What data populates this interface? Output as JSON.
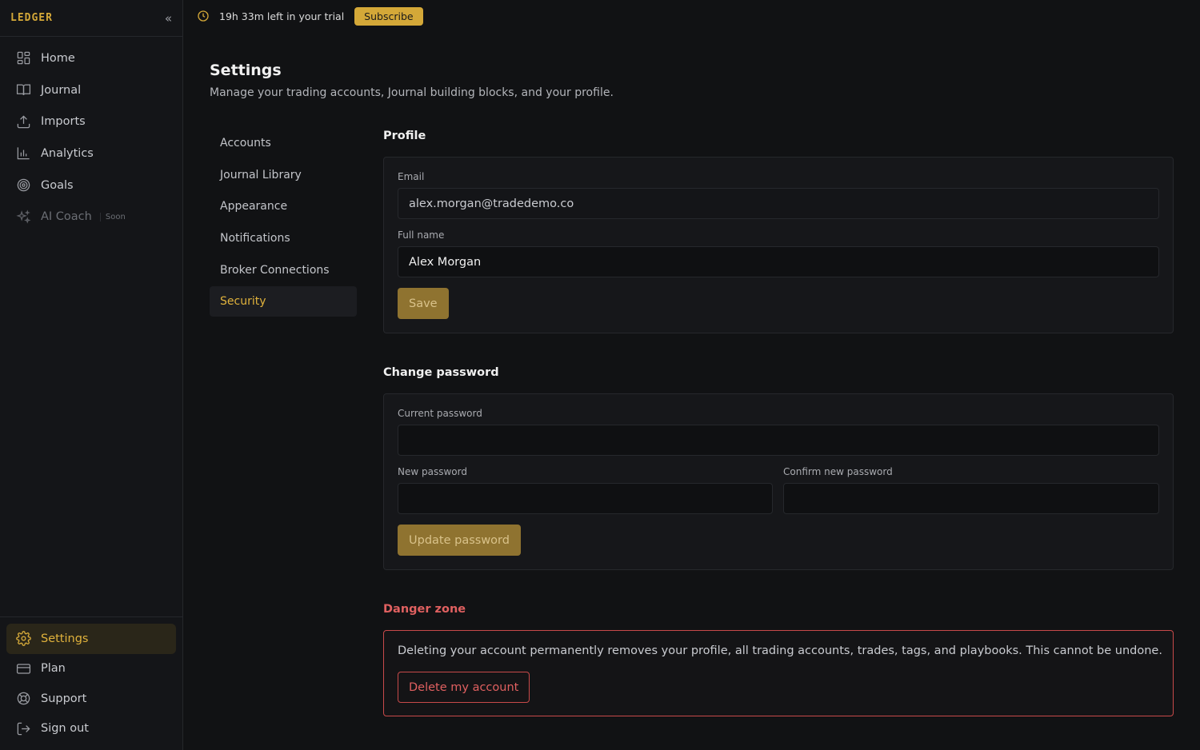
{
  "sidebar": {
    "brand": "LEDGER",
    "collapse_icon": "chevrons-left-icon",
    "nav": [
      {
        "label": "Home",
        "icon": "grid-icon"
      },
      {
        "label": "Journal",
        "icon": "book-icon"
      },
      {
        "label": "Imports",
        "icon": "upload-icon"
      },
      {
        "label": "Analytics",
        "icon": "bar-chart-icon"
      },
      {
        "label": "Goals",
        "icon": "target-icon"
      },
      {
        "label": "AI Coach",
        "icon": "sparkles-icon",
        "badge": "Soon"
      }
    ],
    "bottom": [
      {
        "label": "Settings",
        "icon": "gear-icon",
        "active": true
      },
      {
        "label": "Plan",
        "icon": "credit-card-icon"
      },
      {
        "label": "Support",
        "icon": "lifebuoy-icon"
      },
      {
        "label": "Sign out",
        "icon": "sign-out-icon"
      }
    ]
  },
  "trial": {
    "text": "19h 33m left in your trial",
    "button": "Subscribe"
  },
  "page": {
    "title": "Settings",
    "subtitle": "Manage your trading accounts, Journal building blocks, and your profile."
  },
  "settings_nav": [
    {
      "label": "Accounts"
    },
    {
      "label": "Journal Library"
    },
    {
      "label": "Appearance"
    },
    {
      "label": "Notifications"
    },
    {
      "label": "Broker Connections"
    },
    {
      "label": "Security",
      "active": true
    }
  ],
  "profile": {
    "title": "Profile",
    "email_label": "Email",
    "email_value": "alex.morgan@tradedemo.co",
    "fullname_label": "Full name",
    "fullname_value": "Alex Morgan",
    "save_button": "Save"
  },
  "password": {
    "title": "Change password",
    "current_label": "Current password",
    "new_label": "New password",
    "confirm_label": "Confirm new password",
    "update_button": "Update password"
  },
  "danger": {
    "title": "Danger zone",
    "text": "Deleting your account permanently removes your profile, all trading accounts, trades, tags, and playbooks. This cannot be undone.",
    "button": "Delete my account"
  },
  "colors": {
    "accent": "#d4a838",
    "danger": "#e06060",
    "background": "#111214"
  }
}
